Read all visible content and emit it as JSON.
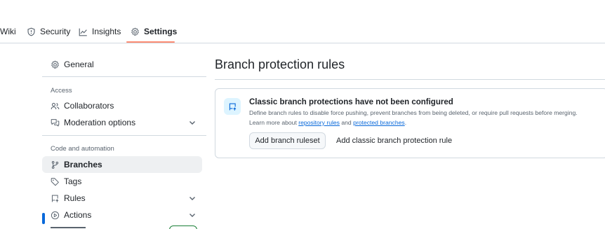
{
  "tabs": [
    {
      "label": "Wiki",
      "icon": "book-icon"
    },
    {
      "label": "Security",
      "icon": "shield-icon"
    },
    {
      "label": "Insights",
      "icon": "graph-icon"
    },
    {
      "label": "Settings",
      "icon": "gear-icon",
      "active": true
    }
  ],
  "sidebar": {
    "general": "General",
    "access_heading": "Access",
    "collaborators": "Collaborators",
    "moderation": "Moderation options",
    "code_heading": "Code and automation",
    "branches": "Branches",
    "tags": "Tags",
    "rules": "Rules",
    "actions": "Actions"
  },
  "main": {
    "title": "Branch protection rules",
    "card": {
      "title": "Classic branch protections have not been configured",
      "description": "Define branch rules to disable force pushing, prevent branches from being deleted, or require pull requests before merging.",
      "learn_prefix": "Learn more about ",
      "link_repository_rules": "repository rules",
      "learn_and": " and ",
      "link_protected_branches": "protected branches",
      "learn_suffix": ".",
      "add_ruleset_button": "Add branch ruleset",
      "add_classic_button": "Add classic branch protection rule"
    }
  },
  "colors": {
    "accent": "#0969da",
    "tab_underline": "#fd8c73",
    "active_bg": "#eef0f2"
  }
}
